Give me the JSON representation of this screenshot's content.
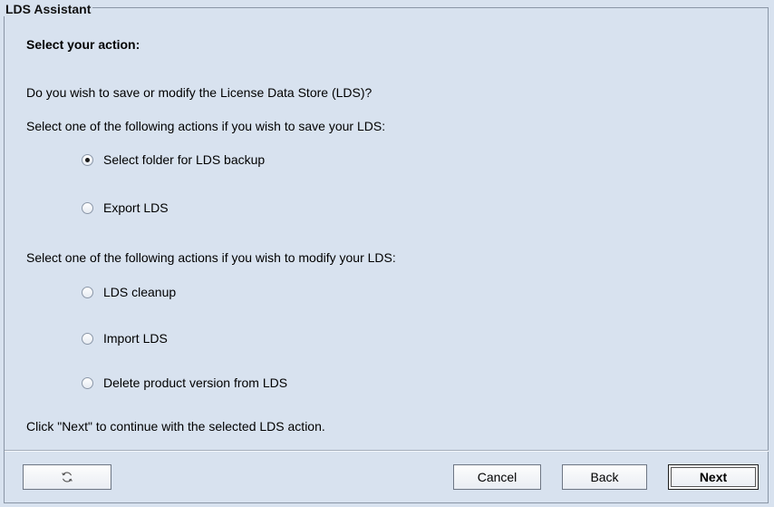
{
  "window": {
    "group_title": "LDS Assistant"
  },
  "main": {
    "heading": "Select your action:",
    "question": "Do you wish to save or modify the License Data Store (LDS)?",
    "save_section_label": "Select one of the following actions if you wish to save your LDS:",
    "save_options": [
      {
        "label": "Select folder for LDS backup",
        "selected": true
      },
      {
        "label": "Export LDS",
        "selected": false
      }
    ],
    "modify_section_label": "Select one of the following actions if you wish to modify your LDS:",
    "modify_options": [
      {
        "label": "LDS cleanup",
        "selected": false
      },
      {
        "label": "Import LDS",
        "selected": false
      },
      {
        "label": "Delete product version from LDS",
        "selected": false
      }
    ],
    "footer_hint": "Click \"Next\" to continue with the selected LDS action."
  },
  "buttons": {
    "refresh_icon": "refresh-icon",
    "cancel_label": "Cancel",
    "back_label": "Back",
    "next_label": "Next"
  }
}
